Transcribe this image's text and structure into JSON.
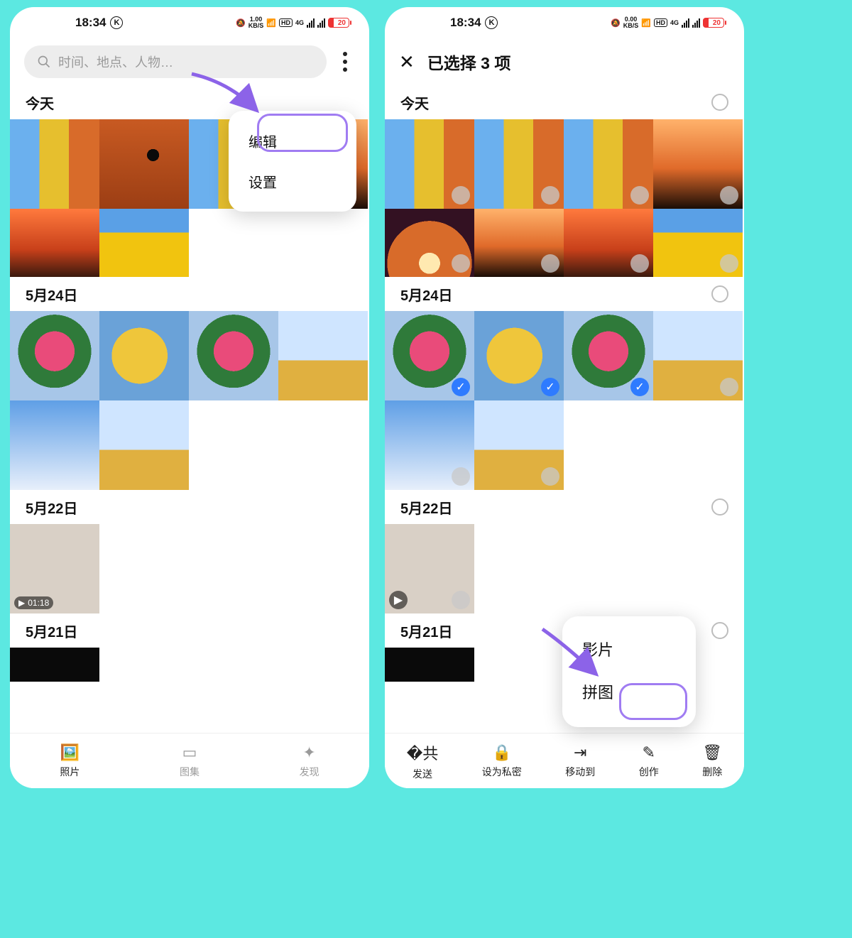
{
  "left": {
    "status": {
      "time": "18:34",
      "net": "1.00",
      "netunit": "KB/S",
      "hd": "HD",
      "sig": "4G",
      "batt": "20"
    },
    "search_placeholder": "时间、地点、人物…",
    "sections": {
      "today": "今天",
      "d524": "5月24日",
      "d522": "5月22日",
      "d521": "5月21日"
    },
    "video_dur": "01:18",
    "popup": {
      "edit": "编辑",
      "settings": "设置"
    },
    "bottom": {
      "photos": "照片",
      "albums": "图集",
      "discover": "发现"
    }
  },
  "right": {
    "status": {
      "time": "18:34",
      "net": "0.00",
      "netunit": "KB/S",
      "hd": "HD",
      "sig": "4G",
      "batt": "20"
    },
    "title": "已选择 3 项",
    "sections": {
      "today": "今天",
      "d524": "5月24日",
      "d522": "5月22日",
      "d521": "5月21日"
    },
    "create": {
      "movie": "影片",
      "collage": "拼图"
    },
    "bottom": {
      "send": "发送",
      "private": "设为私密",
      "move": "移动到",
      "create": "创作",
      "delete": "删除"
    }
  }
}
